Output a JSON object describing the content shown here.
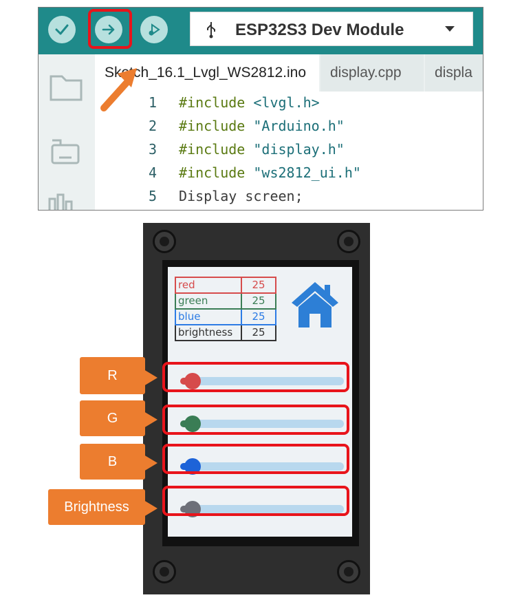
{
  "ide": {
    "toolbar": {
      "verify_icon": "check-icon",
      "upload_icon": "arrow-right-icon",
      "debug_icon": "debug-icon",
      "board_icon": "usb-icon",
      "board_name": "ESP32S3 Dev Module",
      "dropdown_icon": "caret-down-icon"
    },
    "tabs": [
      {
        "label": "Sketch_16.1_Lvgl_WS2812.ino"
      },
      {
        "label": "display.cpp"
      },
      {
        "label": "displa"
      }
    ],
    "code_lines": [
      {
        "num": "1",
        "kw": "#include",
        "rest": " <lvgl.h>"
      },
      {
        "num": "2",
        "kw": "#include",
        "rest": " \"Arduino.h\""
      },
      {
        "num": "3",
        "kw": "#include",
        "rest": " \"display.h\""
      },
      {
        "num": "4",
        "kw": "#include",
        "rest": " \"ws2812_ui.h\""
      },
      {
        "num": "5",
        "kw": "",
        "rest": "Display screen;"
      }
    ]
  },
  "device": {
    "table": [
      {
        "name": "red",
        "value": "25"
      },
      {
        "name": "green",
        "value": "25"
      },
      {
        "name": "blue",
        "value": "25"
      },
      {
        "name": "brightness",
        "value": "25"
      }
    ],
    "home_icon": "home-icon",
    "sliders": [
      {
        "label": "R",
        "color": "#d64b4b"
      },
      {
        "label": "G",
        "color": "#3a7d55"
      },
      {
        "label": "B",
        "color": "#1d63d8"
      },
      {
        "label": "Brightness",
        "color": "#6d6f78"
      }
    ]
  },
  "colors": {
    "accent": "#1f8a8a",
    "highlight": "#e8141b",
    "callout": "#ec7d2f"
  }
}
